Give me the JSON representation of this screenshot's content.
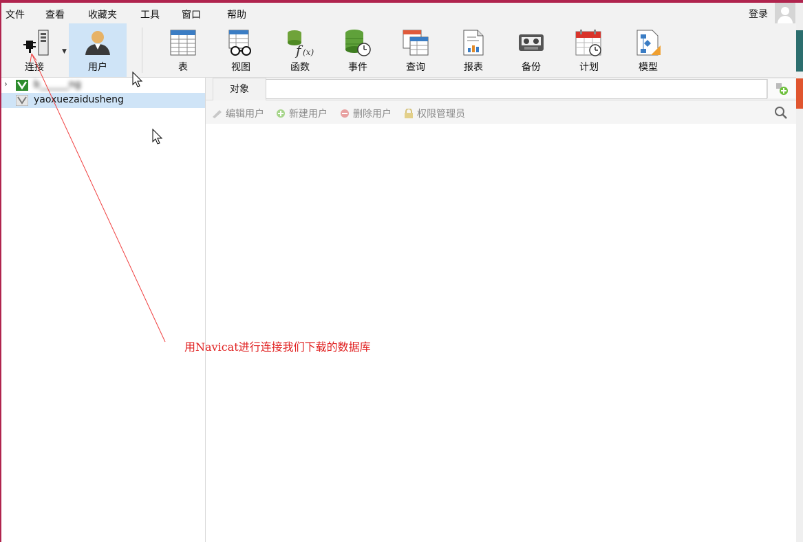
{
  "menubar": {
    "items": [
      "文件",
      "查看",
      "收藏夹",
      "工具",
      "窗口",
      "帮助"
    ],
    "login_label": "登录"
  },
  "toolbar": {
    "connect_label": "连接",
    "user_label": "用户",
    "table_label": "表",
    "view_label": "视图",
    "function_label": "函数",
    "event_label": "事件",
    "query_label": "查询",
    "report_label": "报表",
    "backup_label": "备份",
    "schedule_label": "计划",
    "model_label": "模型"
  },
  "tree": {
    "connections": [
      {
        "name": "b______ng",
        "expanded": false,
        "selected": false,
        "icon": "mysql-connection-icon"
      },
      {
        "name": "yaoxuezaidusheng",
        "expanded": false,
        "selected": true,
        "icon": "connection-icon"
      }
    ]
  },
  "object_pane": {
    "tab_label": "对象",
    "actions": {
      "edit_user": "编辑用户",
      "new_user": "新建用户",
      "delete_user": "删除用户",
      "privilege_manager": "权限管理员"
    }
  },
  "annotation": {
    "text": "用Navicat进行连接我们下载的数据库",
    "color": "#e02020"
  },
  "colors": {
    "window_border": "#b0244e",
    "active_toolbar": "#cfe4f7",
    "selected_row": "#cfe4f7"
  }
}
